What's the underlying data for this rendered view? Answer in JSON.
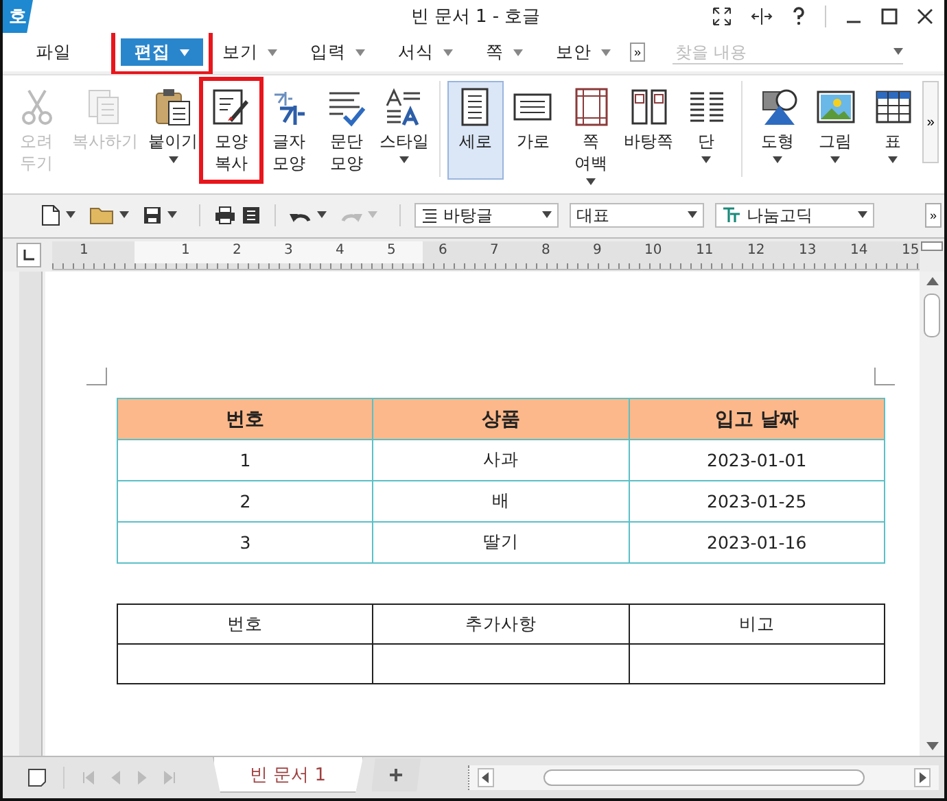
{
  "window": {
    "title": "빈 문서 1 - 호글",
    "logo": "호"
  },
  "menu": [
    {
      "label": "파일",
      "dropdown": false,
      "selected": false,
      "highlighted": false
    },
    {
      "label": "편집",
      "dropdown": true,
      "selected": true,
      "highlighted": true
    },
    {
      "label": "보기",
      "dropdown": true,
      "selected": false,
      "highlighted": false
    },
    {
      "label": "입력",
      "dropdown": true,
      "selected": false,
      "highlighted": false
    },
    {
      "label": "서식",
      "dropdown": true,
      "selected": false,
      "highlighted": false
    },
    {
      "label": "쪽",
      "dropdown": true,
      "selected": false,
      "highlighted": false
    },
    {
      "label": "보안",
      "dropdown": true,
      "selected": false,
      "highlighted": false
    }
  ],
  "more_button": "»",
  "search": {
    "placeholder": "찾을 내용"
  },
  "ribbon": [
    {
      "kind": "scissors",
      "lines": [
        "오려",
        "두기"
      ],
      "disabled": true,
      "selected": false,
      "highlighted": false,
      "dropdown": false,
      "group_end": false
    },
    {
      "kind": "copy",
      "lines": [
        "복사하기"
      ],
      "disabled": true,
      "selected": false,
      "highlighted": false,
      "dropdown": false,
      "group_end": false
    },
    {
      "kind": "paste",
      "lines": [
        "붙이기"
      ],
      "disabled": false,
      "selected": false,
      "highlighted": false,
      "dropdown": true,
      "group_end": false
    },
    {
      "kind": "format-painter",
      "lines": [
        "모양",
        "복사"
      ],
      "disabled": false,
      "selected": false,
      "highlighted": true,
      "dropdown": false,
      "group_end": false
    },
    {
      "kind": "char-shape",
      "lines": [
        "글자",
        "모양"
      ],
      "disabled": false,
      "selected": false,
      "highlighted": false,
      "dropdown": false,
      "group_end": false
    },
    {
      "kind": "para-shape",
      "lines": [
        "문단",
        "모양"
      ],
      "disabled": false,
      "selected": false,
      "highlighted": false,
      "dropdown": false,
      "group_end": false
    },
    {
      "kind": "style",
      "lines": [
        "스타일"
      ],
      "disabled": false,
      "selected": false,
      "highlighted": false,
      "dropdown": true,
      "group_end": true
    },
    {
      "kind": "portrait",
      "lines": [
        "세로"
      ],
      "disabled": false,
      "selected": true,
      "highlighted": false,
      "dropdown": false,
      "group_end": false
    },
    {
      "kind": "landscape",
      "lines": [
        "가로"
      ],
      "disabled": false,
      "selected": false,
      "highlighted": false,
      "dropdown": false,
      "group_end": false
    },
    {
      "kind": "margins",
      "lines": [
        "쪽",
        "여백"
      ],
      "disabled": false,
      "selected": false,
      "highlighted": false,
      "dropdown": true,
      "group_end": false
    },
    {
      "kind": "master",
      "lines": [
        "바탕쪽"
      ],
      "disabled": false,
      "selected": false,
      "highlighted": false,
      "dropdown": false,
      "group_end": false
    },
    {
      "kind": "columns",
      "lines": [
        "단"
      ],
      "disabled": false,
      "selected": false,
      "highlighted": false,
      "dropdown": true,
      "group_end": true
    },
    {
      "kind": "shapes",
      "lines": [
        "도형"
      ],
      "disabled": false,
      "selected": false,
      "highlighted": false,
      "dropdown": true,
      "group_end": false
    },
    {
      "kind": "picture",
      "lines": [
        "그림"
      ],
      "disabled": false,
      "selected": false,
      "highlighted": false,
      "dropdown": true,
      "group_end": false
    },
    {
      "kind": "table",
      "lines": [
        "표"
      ],
      "disabled": false,
      "selected": false,
      "highlighted": false,
      "dropdown": true,
      "group_end": false
    }
  ],
  "toolbar": {
    "style": "바탕글",
    "font_group": "대표",
    "font": "나눔고딕"
  },
  "ruler": [
    "1",
    "1",
    "2",
    "3",
    "4",
    "5",
    "6",
    "7",
    "8",
    "9",
    "10",
    "11",
    "12",
    "13",
    "14",
    "15"
  ],
  "table1": {
    "columns": [
      "번호",
      "상품",
      "입고  날짜"
    ],
    "rows": [
      [
        "1",
        "사과",
        "2023-01-01"
      ],
      [
        "2",
        "배",
        "2023-01-25"
      ],
      [
        "3",
        "딸기",
        "2023-01-16"
      ]
    ]
  },
  "table2": {
    "columns": [
      "번호",
      "추가사항",
      "비고"
    ],
    "rows": [
      [
        "",
        "",
        ""
      ]
    ]
  },
  "tabs": [
    {
      "label": "빈 문서 1",
      "selected": true
    }
  ],
  "add_tab": "+"
}
